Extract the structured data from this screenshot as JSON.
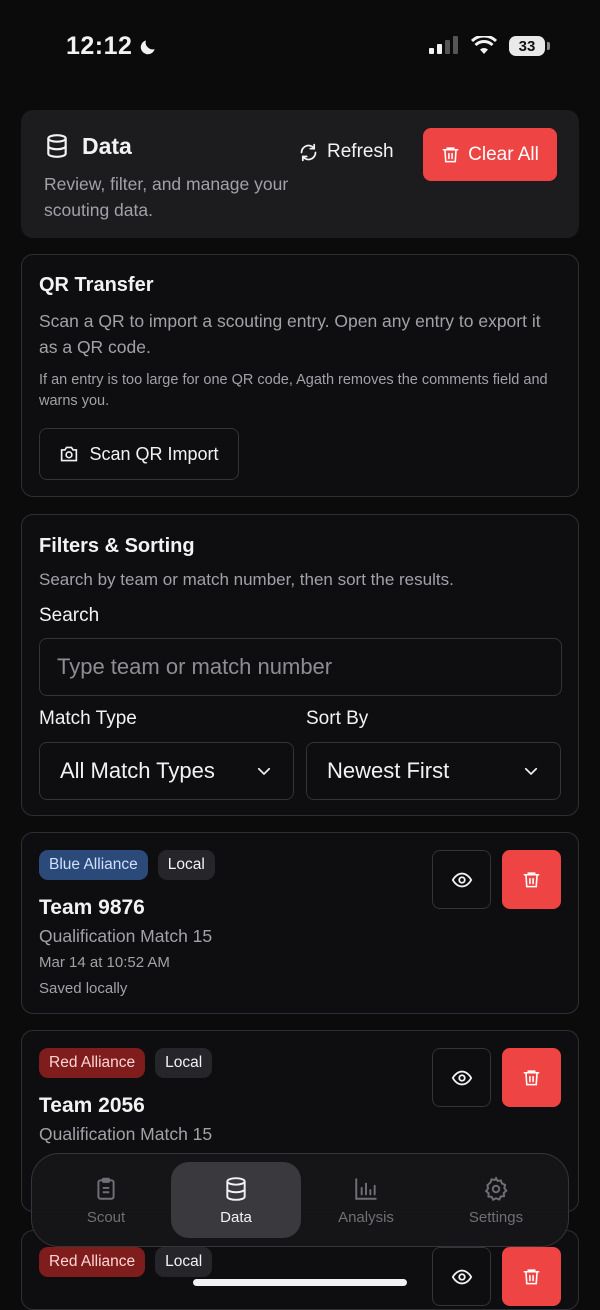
{
  "status": {
    "time": "12:12",
    "battery": "33"
  },
  "header": {
    "title": "Data",
    "subtitle": "Review, filter, and manage your scouting data.",
    "refresh_label": "Refresh",
    "clear_label": "Clear All"
  },
  "qr": {
    "title": "QR Transfer",
    "description": "Scan a QR to import a scouting entry. Open any entry to export it as a QR code.",
    "note": "If an entry is too large for one QR code, Agath removes the comments field and warns you.",
    "scan_label": "Scan QR Import"
  },
  "filters": {
    "title": "Filters & Sorting",
    "description": "Search by team or match number, then sort the results.",
    "search_label": "Search",
    "search_placeholder": "Type team or match number",
    "match_type_label": "Match Type",
    "match_type_value": "All Match Types",
    "sort_label": "Sort By",
    "sort_value": "Newest First"
  },
  "entries": [
    {
      "alliance": "Blue Alliance",
      "source": "Local",
      "team": "Team 9876",
      "match": "Qualification Match 15",
      "time": "Mar 14 at 10:52 AM",
      "status": "Saved locally"
    },
    {
      "alliance": "Red Alliance",
      "source": "Local",
      "team": "Team 2056",
      "match": "Qualification Match 15"
    },
    {
      "alliance": "Red Alliance",
      "source": "Local"
    }
  ],
  "nav": {
    "items": [
      {
        "label": "Scout",
        "icon": "clipboard-icon"
      },
      {
        "label": "Data",
        "icon": "database-icon",
        "active": true
      },
      {
        "label": "Analysis",
        "icon": "bar-chart-icon"
      },
      {
        "label": "Settings",
        "icon": "gear-icon"
      }
    ]
  },
  "colors": {
    "accent_red": "#ef4444",
    "blue_badge": "#2b4a7a",
    "red_badge": "#7f1d1d",
    "background": "#0b0b0c"
  }
}
